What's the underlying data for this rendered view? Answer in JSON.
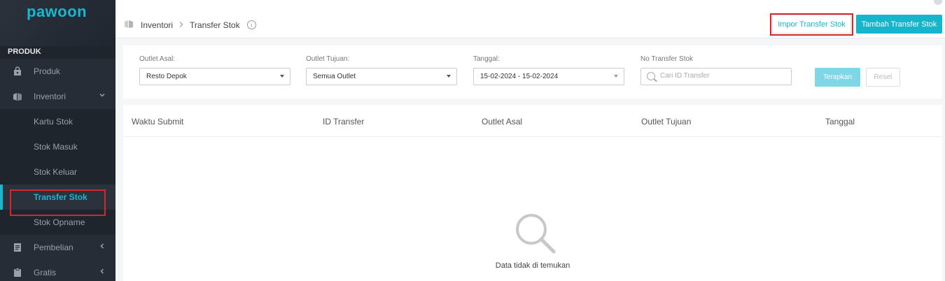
{
  "brand": {
    "logo": "pawoon"
  },
  "sidebar": {
    "section": "PRODUK",
    "items": [
      {
        "label": "Produk",
        "icon": "bag-icon"
      },
      {
        "label": "Inventori",
        "icon": "box-icon"
      },
      {
        "label": "Kartu Stok"
      },
      {
        "label": "Stok Masuk"
      },
      {
        "label": "Stok Keluar"
      },
      {
        "label": "Transfer Stok"
      },
      {
        "label": "Stok Opname"
      },
      {
        "label": "Pembelian",
        "icon": "document-icon"
      },
      {
        "label": "Gratis",
        "icon": "clipboard-icon"
      }
    ]
  },
  "header": {
    "crumb_root": "Inventori",
    "crumb_current": "Transfer Stok",
    "import_label": "Impor Transfer Stok",
    "add_label": "Tambah Transfer Stok"
  },
  "filter": {
    "origin_label": "Outlet Asal:",
    "origin_value": "Resto Depok",
    "dest_label": "Outlet Tujuan:",
    "dest_value": "Semua Outlet",
    "date_label": "Tanggal:",
    "date_value": "15-02-2024 - 15-02-2024",
    "transfer_label": "No Transfer Stok",
    "transfer_placeholder": "Cari ID Transfer",
    "apply_label": "Terapkan",
    "reset_label": "Reset"
  },
  "table": {
    "columns": [
      "Waktu Submit",
      "ID Transfer",
      "Outlet Asal",
      "Outlet Tujuan",
      "Tanggal"
    ],
    "empty_message": "Data tidak di temukan"
  },
  "colors": {
    "accent": "#15b5ce",
    "highlight": "#d4262d",
    "sidebar_bg": "#1f252d"
  }
}
